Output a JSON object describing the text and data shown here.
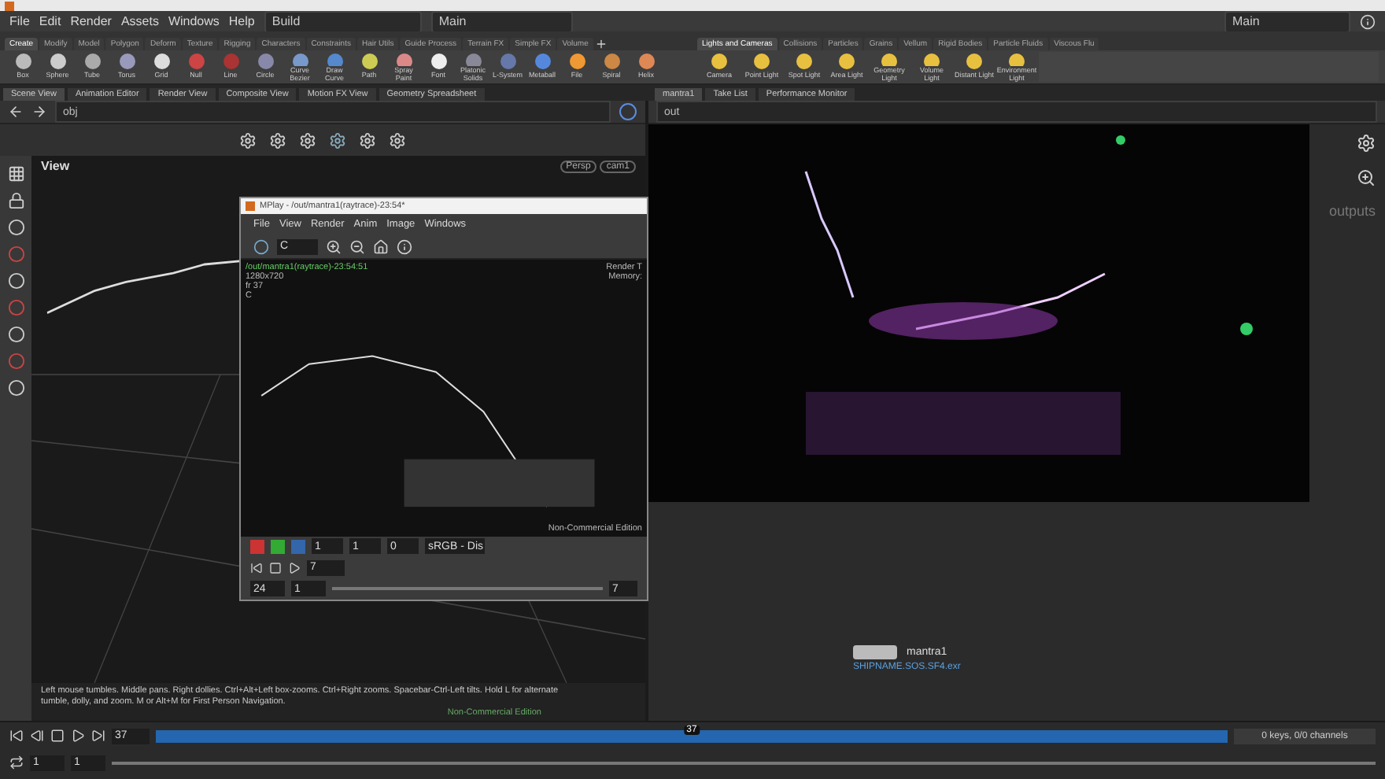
{
  "menu": [
    "File",
    "Edit",
    "Render",
    "Assets",
    "Windows",
    "Help"
  ],
  "desktop": "Build",
  "layout": "Main",
  "layout_right": "Main",
  "shelf_tabs_left": [
    {
      "label": "Create",
      "selected": true
    },
    {
      "label": "Modify",
      "selected": false
    },
    {
      "label": "Model",
      "selected": false
    },
    {
      "label": "Polygon",
      "selected": false
    },
    {
      "label": "Deform",
      "selected": false
    },
    {
      "label": "Texture",
      "selected": false
    },
    {
      "label": "Rigging",
      "selected": false
    },
    {
      "label": "Characters",
      "selected": false
    },
    {
      "label": "Constraints",
      "selected": false
    },
    {
      "label": "Hair Utils",
      "selected": false
    },
    {
      "label": "Guide Process",
      "selected": false
    },
    {
      "label": "Terrain FX",
      "selected": false
    },
    {
      "label": "Simple FX",
      "selected": false
    },
    {
      "label": "Volume",
      "selected": false
    }
  ],
  "shelf_tabs_right": [
    {
      "label": "Lights and Cameras",
      "selected": true
    },
    {
      "label": "Collisions",
      "selected": false
    },
    {
      "label": "Particles",
      "selected": false
    },
    {
      "label": "Grains",
      "selected": false
    },
    {
      "label": "Vellum",
      "selected": false
    },
    {
      "label": "Rigid Bodies",
      "selected": false
    },
    {
      "label": "Particle Fluids",
      "selected": false
    },
    {
      "label": "Viscous Flu",
      "selected": false
    }
  ],
  "tools_left": [
    "Box",
    "Sphere",
    "Tube",
    "Torus",
    "Grid",
    "Null",
    "Line",
    "Circle",
    "Curve Bezier",
    "Draw Curve",
    "Path",
    "Spray Paint",
    "Font",
    "Platonic Solids",
    "L-System",
    "Metaball",
    "File",
    "Spiral",
    "Helix"
  ],
  "tools_right": [
    "Camera",
    "Point Light",
    "Spot Light",
    "Area Light",
    "Geometry Light",
    "Volume Light",
    "Distant Light",
    "Environment Light"
  ],
  "pane_tabs_left": [
    {
      "label": "Scene View",
      "selected": true
    },
    {
      "label": "Animation Editor",
      "selected": false
    },
    {
      "label": "Render View",
      "selected": false
    },
    {
      "label": "Composite View",
      "selected": false
    },
    {
      "label": "Motion FX View",
      "selected": false
    },
    {
      "label": "Geometry Spreadsheet",
      "selected": false
    }
  ],
  "pane_tabs_right": [
    {
      "label": "mantra1",
      "selected": true
    },
    {
      "label": "Take List",
      "selected": false
    },
    {
      "label": "Performance Monitor",
      "selected": false
    }
  ],
  "scene_view": {
    "path": "obj",
    "title": "View",
    "camera_menus": [
      "Persp",
      "cam1"
    ],
    "status": "Left mouse tumbles. Middle pans. Right dollies. Ctrl+Alt+Left box-zooms. Ctrl+Right zooms. Spacebar-Ctrl-Left tilts. Hold L for alternate tumble, dolly, and zoom. M or Alt+M for First Person Navigation.",
    "edition": "Non-Commercial Edition"
  },
  "mplay": {
    "title": "MPlay - /out/mantra1(raytrace)-23:54*",
    "menu": [
      "File",
      "View",
      "Render",
      "Anim",
      "Image",
      "Windows"
    ],
    "channel_field": "C",
    "render_path": "/out/mantra1(raytrace)-23:54:51",
    "resolution": "1280x720",
    "frame_info": "fr 37",
    "channel": "C",
    "render_time": "Render T",
    "memory": "Memory:",
    "edition": "Non-Commercial Edition",
    "gamma": "1",
    "exposure": "1",
    "level": "0",
    "lut": "sRGB - Dis",
    "frame": "7",
    "fps": "24",
    "range_start": "1",
    "range_end": "7"
  },
  "render_view": {
    "path": "out",
    "node": "mantra1",
    "file": "SHIPNAME.SOS.SF4.exr",
    "outputs": "outputs"
  },
  "timeline": {
    "frame": "37",
    "marker": "37",
    "level": 0.5,
    "start": "1",
    "end": "1",
    "keys": "0 keys, 0/0 channels"
  }
}
